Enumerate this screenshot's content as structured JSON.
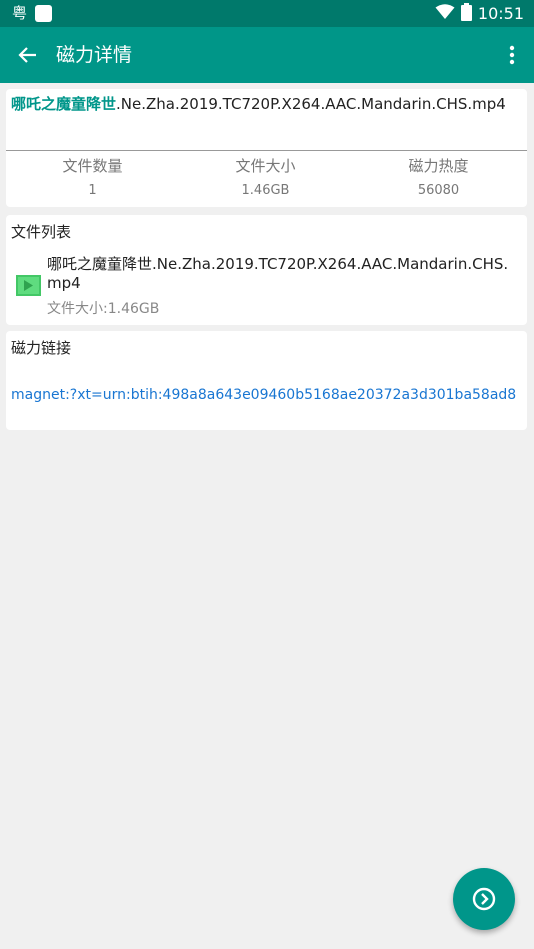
{
  "status_bar": {
    "app_icon_char": "粤",
    "time": "10:51",
    "icons": [
      "app-icon",
      "square-notification-icon",
      "wifi-icon",
      "battery-icon"
    ]
  },
  "toolbar": {
    "title": "磁力详情",
    "back_icon": "arrow-left-icon",
    "menu_icon": "more-vertical-icon"
  },
  "details": {
    "name_highlight": "哪吒之魔童降世",
    "name_rest": ".Ne.Zha.2019.TC720P.X264.AAC.Mandarin.CHS.mp4",
    "stats": [
      {
        "label": "文件数量",
        "value": "1"
      },
      {
        "label": "文件大小",
        "value": "1.46GB"
      },
      {
        "label": "磁力热度",
        "value": "56080"
      }
    ]
  },
  "file_list": {
    "header": "文件列表",
    "items": [
      {
        "name": "哪吒之魔童降世.Ne.Zha.2019.TC720P.X264.AAC.Mandarin.CHS.mp4",
        "size": "文件大小:1.46GB",
        "icon": "video-file-icon"
      }
    ]
  },
  "magnet": {
    "header": "磁力链接",
    "link": "magnet:?xt=urn:btih:498a8a643e09460b5168ae20372a3d301ba58ad8"
  },
  "fab": {
    "icon": "chevron-right-circle-icon"
  },
  "colors": {
    "status_bar": "#00796b",
    "toolbar": "#009688",
    "accent": "#00968a",
    "link": "#1976d2",
    "background": "#f0f0f0"
  }
}
